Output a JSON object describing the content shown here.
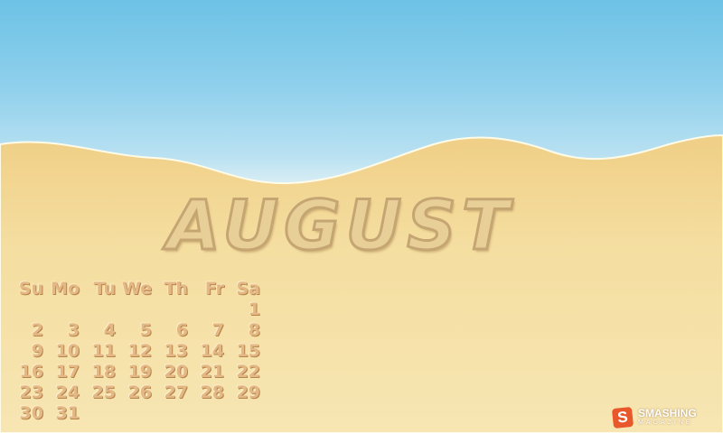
{
  "wallpaper": {
    "month_title": "AUGUST",
    "sky_color": "#8fd0ec",
    "sand_color": "#f3dc9e"
  },
  "calendar": {
    "weekday_headers": [
      "Su",
      "Mo",
      "Tu",
      "We",
      "Th",
      "Fr",
      "Sa"
    ],
    "weeks": [
      [
        "",
        "",
        "",
        "",
        "",
        "",
        "1"
      ],
      [
        "2",
        "3",
        "4",
        "5",
        "6",
        "7",
        "8"
      ],
      [
        "9",
        "10",
        "11",
        "12",
        "13",
        "14",
        "15"
      ],
      [
        "16",
        "17",
        "18",
        "19",
        "20",
        "21",
        "22"
      ],
      [
        "23",
        "24",
        "25",
        "26",
        "27",
        "28",
        "29"
      ],
      [
        "30",
        "31",
        "",
        "",
        "",
        "",
        ""
      ]
    ]
  },
  "logo": {
    "mark": "S",
    "name": "SMASHING",
    "subtitle": "MAGAZINE",
    "mark_color": "#e8582b"
  }
}
